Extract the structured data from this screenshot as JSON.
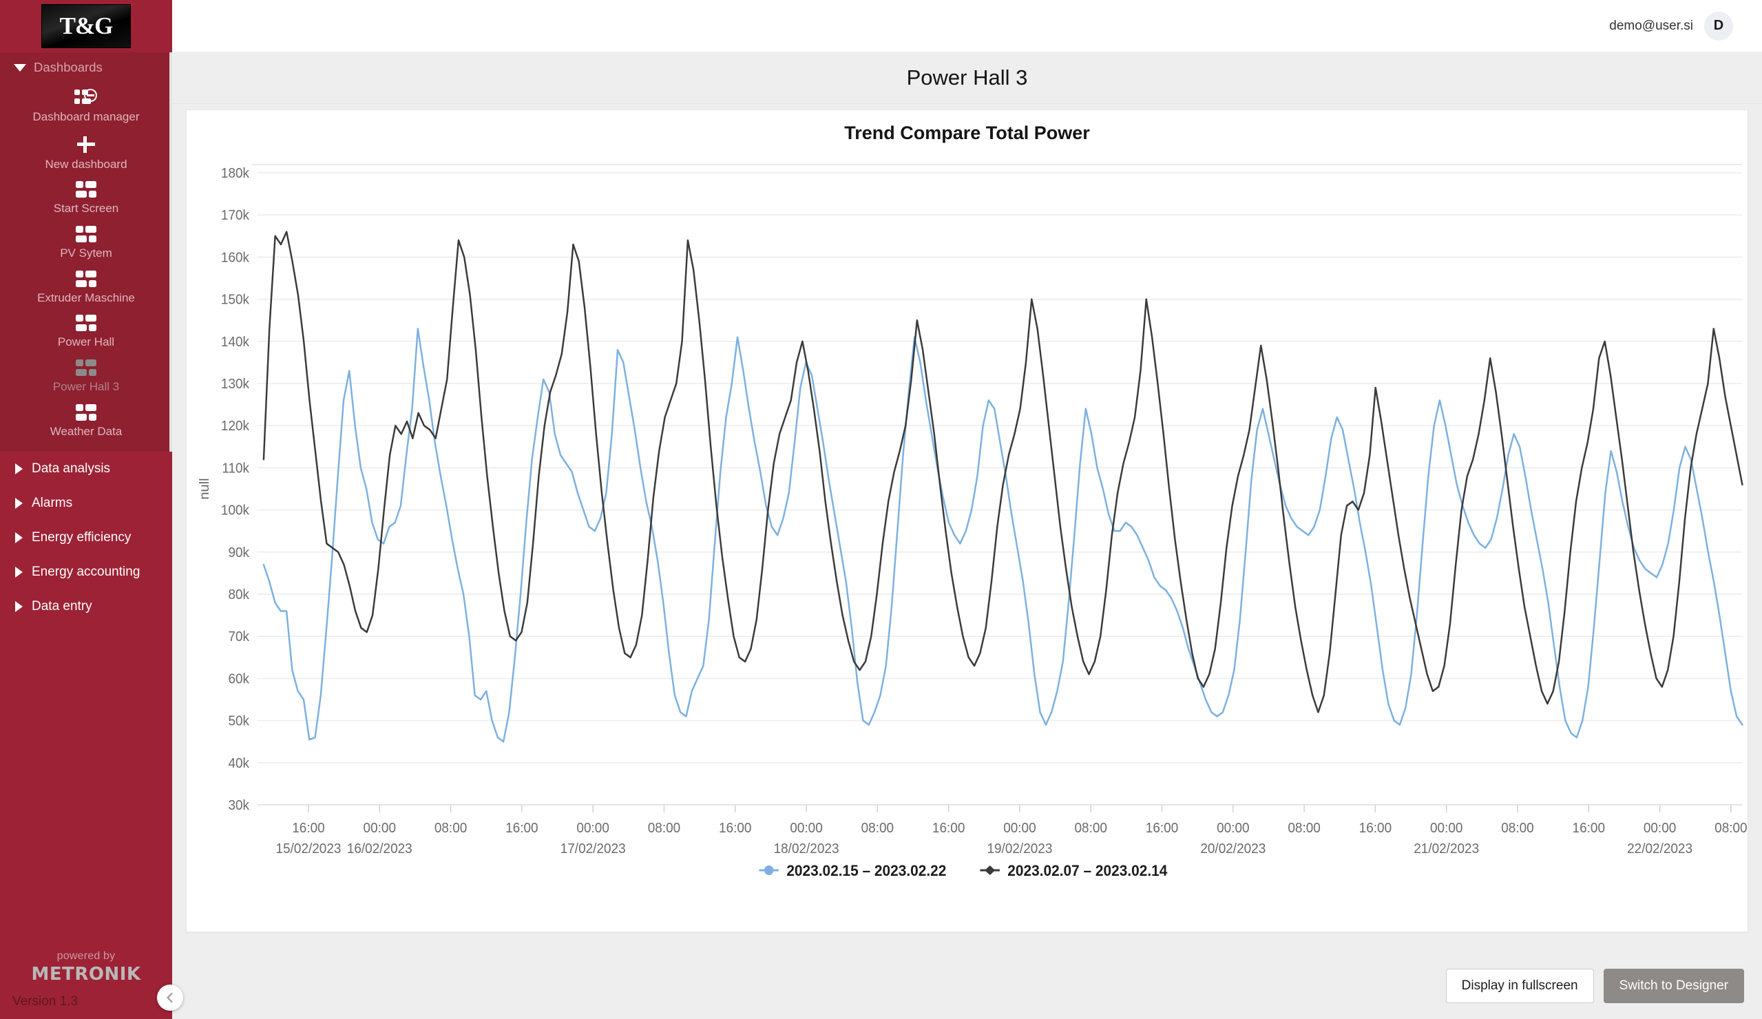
{
  "brand": {
    "logo_text": "T&G",
    "powered_by": "powered by",
    "company": "METRONIK",
    "version": "Version 1.3"
  },
  "topbar": {
    "user_email": "demo@user.si",
    "avatar_initial": "D"
  },
  "sidebar": {
    "dashboards_label": "Dashboards",
    "dashboard_items": [
      {
        "label": "Dashboard manager",
        "icon": "dashboard-manager-icon",
        "active": false
      },
      {
        "label": "New dashboard",
        "icon": "plus-icon",
        "active": false
      },
      {
        "label": "Start Screen",
        "icon": "tiles-icon",
        "active": false
      },
      {
        "label": "PV Sytem",
        "icon": "tiles-icon",
        "active": false
      },
      {
        "label": "Extruder Maschine",
        "icon": "tiles-icon",
        "active": false
      },
      {
        "label": "Power Hall",
        "icon": "tiles-icon",
        "active": false
      },
      {
        "label": "Power Hall 3",
        "icon": "tiles-icon",
        "active": true
      },
      {
        "label": "Weather Data",
        "icon": "tiles-icon",
        "active": false
      }
    ],
    "menu_groups": [
      {
        "label": "Data analysis",
        "icon": "caret-right-icon"
      },
      {
        "label": "Alarms",
        "icon": "caret-right-icon"
      },
      {
        "label": "Energy efficiency",
        "icon": "caret-right-icon"
      },
      {
        "label": "Energy accounting",
        "icon": "caret-right-icon"
      },
      {
        "label": "Data entry",
        "icon": "caret-right-icon"
      }
    ],
    "collapse_icon": "chevron-left-icon"
  },
  "page": {
    "title": "Power Hall 3"
  },
  "footer": {
    "fullscreen_label": "Display in fullscreen",
    "designer_label": "Switch to Designer"
  },
  "colors": {
    "brand_red": "#9d2235",
    "series_blue": "#7cb0e0",
    "series_black": "#3a3a3a",
    "grid": "#ebebeb"
  },
  "chart_data": {
    "type": "line",
    "title": "Trend Compare Total Power",
    "xlabel": "",
    "ylabel": "null",
    "ylim": [
      30000,
      180000
    ],
    "ytick_labels": [
      "180k",
      "170k",
      "160k",
      "150k",
      "140k",
      "130k",
      "120k",
      "110k",
      "100k",
      "90k",
      "80k",
      "70k",
      "60k",
      "50k",
      "40k",
      "30k"
    ],
    "ytick_values": [
      180000,
      170000,
      160000,
      150000,
      140000,
      130000,
      120000,
      110000,
      100000,
      90000,
      80000,
      70000,
      60000,
      50000,
      40000,
      30000
    ],
    "grid": true,
    "legend_position": "bottom",
    "xtick_labels": [
      {
        "time": "16:00",
        "date": "15/02/2023"
      },
      {
        "time": "00:00",
        "date": "16/02/2023"
      },
      {
        "time": "08:00",
        "date": ""
      },
      {
        "time": "16:00",
        "date": ""
      },
      {
        "time": "00:00",
        "date": "17/02/2023"
      },
      {
        "time": "08:00",
        "date": ""
      },
      {
        "time": "16:00",
        "date": ""
      },
      {
        "time": "00:00",
        "date": "18/02/2023"
      },
      {
        "time": "08:00",
        "date": ""
      },
      {
        "time": "16:00",
        "date": ""
      },
      {
        "time": "00:00",
        "date": "19/02/2023"
      },
      {
        "time": "08:00",
        "date": ""
      },
      {
        "time": "16:00",
        "date": ""
      },
      {
        "time": "00:00",
        "date": "20/02/2023"
      },
      {
        "time": "08:00",
        "date": ""
      },
      {
        "time": "16:00",
        "date": ""
      },
      {
        "time": "00:00",
        "date": "21/02/2023"
      },
      {
        "time": "08:00",
        "date": ""
      },
      {
        "time": "16:00",
        "date": ""
      },
      {
        "time": "00:00",
        "date": "22/02/2023"
      },
      {
        "time": "08:00",
        "date": ""
      }
    ],
    "xtick_positions": [
      0.0303,
      0.0784,
      0.1265,
      0.1746,
      0.2227,
      0.2708,
      0.3189,
      0.367,
      0.4151,
      0.4632,
      0.5113,
      0.5594,
      0.6075,
      0.6556,
      0.7037,
      0.7518,
      0.7999,
      0.848,
      0.8961,
      0.9442,
      0.9923
    ],
    "series": [
      {
        "name": "2023.02.15 – 2023.02.22",
        "color": "#7cb0e0",
        "marker": "circle",
        "values": [
          87000,
          83000,
          78000,
          76000,
          76000,
          62000,
          57000,
          55000,
          45500,
          46000,
          56000,
          72000,
          89000,
          108000,
          126000,
          133000,
          120000,
          110000,
          105000,
          97000,
          93000,
          92000,
          96000,
          97000,
          101000,
          113000,
          124000,
          143000,
          134000,
          126000,
          116000,
          108000,
          101000,
          93000,
          86000,
          80000,
          70000,
          56000,
          55000,
          57000,
          50000,
          46000,
          45000,
          52000,
          65000,
          80000,
          97000,
          112000,
          122000,
          131000,
          128000,
          118000,
          113000,
          111000,
          109000,
          104000,
          100000,
          96000,
          95000,
          98000,
          104000,
          118000,
          138000,
          135000,
          127000,
          119000,
          110000,
          102000,
          96000,
          88000,
          78000,
          66000,
          56000,
          52000,
          51000,
          57000,
          60000,
          63000,
          74000,
          92000,
          109000,
          122000,
          130000,
          141000,
          133000,
          124000,
          116000,
          109000,
          101000,
          96000,
          94000,
          98000,
          104000,
          116000,
          129000,
          135000,
          132000,
          124000,
          116000,
          107000,
          99000,
          91000,
          83000,
          72000,
          59000,
          50000,
          49000,
          52000,
          56000,
          63000,
          77000,
          95000,
          113000,
          128000,
          141000,
          135000,
          126000,
          118000,
          110000,
          103000,
          97000,
          94000,
          92000,
          95000,
          100000,
          108000,
          120000,
          126000,
          124000,
          116000,
          108000,
          99000,
          91000,
          83000,
          73000,
          61000,
          52000,
          49000,
          52000,
          57000,
          64000,
          78000,
          94000,
          111000,
          124000,
          118000,
          110000,
          105000,
          99000,
          95000,
          95000,
          97000,
          96000,
          94000,
          91000,
          88000,
          84000,
          82000,
          81000,
          79000,
          76000,
          72000,
          67000,
          63000,
          59000,
          55000,
          52000,
          51000,
          52000,
          56000,
          62000,
          74000,
          90000,
          107000,
          119000,
          124000,
          118000,
          112000,
          106000,
          101000,
          98000,
          96000,
          95000,
          94000,
          96000,
          100000,
          108000,
          117000,
          122000,
          119000,
          112000,
          105000,
          97000,
          90000,
          82000,
          72000,
          62000,
          54000,
          50000,
          49000,
          53000,
          61000,
          75000,
          92000,
          108000,
          120000,
          126000,
          120000,
          113000,
          106000,
          101000,
          97000,
          94000,
          92000,
          91000,
          93000,
          98000,
          105000,
          113000,
          118000,
          115000,
          108000,
          100000,
          93000,
          86000,
          78000,
          68000,
          58000,
          50000,
          47000,
          46000,
          50000,
          58000,
          72000,
          88000,
          104000,
          114000,
          109000,
          102000,
          96000,
          91000,
          88000,
          86000,
          85000,
          84000,
          87000,
          92000,
          100000,
          110000,
          115000,
          112000,
          105000,
          98000,
          90000,
          83000,
          75000,
          66000,
          57000,
          51000,
          49000
        ]
      },
      {
        "name": "2023.02.07 – 2023.02.14",
        "color": "#3a3a3a",
        "marker": "diamond",
        "values": [
          112000,
          143000,
          165000,
          163000,
          166000,
          159000,
          151000,
          140000,
          126000,
          114000,
          102000,
          92000,
          91000,
          90000,
          87000,
          82000,
          76000,
          72000,
          71000,
          75000,
          86000,
          100000,
          113000,
          120000,
          118000,
          121000,
          117000,
          123000,
          120000,
          119000,
          117000,
          124000,
          131000,
          148000,
          164000,
          160000,
          151000,
          138000,
          122000,
          108000,
          96000,
          85000,
          76000,
          70000,
          69000,
          71000,
          78000,
          92000,
          108000,
          120000,
          128000,
          132000,
          137000,
          147000,
          163000,
          159000,
          148000,
          134000,
          118000,
          104000,
          92000,
          81000,
          72000,
          66000,
          65000,
          68000,
          75000,
          88000,
          103000,
          114000,
          122000,
          126000,
          130000,
          140000,
          164000,
          157000,
          145000,
          131000,
          115000,
          101000,
          89000,
          79000,
          70000,
          65000,
          64000,
          67000,
          74000,
          86000,
          100000,
          111000,
          118000,
          122000,
          126000,
          135000,
          140000,
          133000,
          124000,
          114000,
          102000,
          92000,
          83000,
          75000,
          69000,
          64000,
          62000,
          64000,
          70000,
          80000,
          92000,
          102000,
          109000,
          114000,
          120000,
          131000,
          145000,
          138000,
          128000,
          118000,
          106000,
          95000,
          85000,
          77000,
          70000,
          65000,
          63000,
          66000,
          72000,
          83000,
          96000,
          106000,
          113000,
          118000,
          124000,
          135000,
          150000,
          143000,
          132000,
          120000,
          108000,
          96000,
          86000,
          77000,
          70000,
          64000,
          61000,
          64000,
          70000,
          81000,
          94000,
          104000,
          111000,
          116000,
          122000,
          133000,
          150000,
          141000,
          130000,
          118000,
          105000,
          93000,
          83000,
          74000,
          66000,
          60000,
          58000,
          61000,
          67000,
          78000,
          91000,
          101000,
          108000,
          113000,
          119000,
          129000,
          139000,
          131000,
          121000,
          110000,
          98000,
          87000,
          77000,
          69000,
          62000,
          56000,
          52000,
          56000,
          66000,
          80000,
          94000,
          101000,
          102000,
          100000,
          104000,
          113000,
          129000,
          121000,
          112000,
          103000,
          94000,
          86000,
          79000,
          73000,
          67000,
          61000,
          57000,
          58000,
          63000,
          73000,
          87000,
          100000,
          108000,
          112000,
          118000,
          126000,
          136000,
          128000,
          118000,
          107000,
          96000,
          86000,
          77000,
          70000,
          63000,
          57000,
          54000,
          57000,
          64000,
          76000,
          90000,
          102000,
          110000,
          116000,
          124000,
          136000,
          140000,
          132000,
          122000,
          112000,
          101000,
          90000,
          81000,
          73000,
          66000,
          60000,
          58000,
          62000,
          70000,
          83000,
          98000,
          110000,
          118000,
          124000,
          130000,
          143000,
          136000,
          127000,
          120000,
          113000,
          106000
        ]
      }
    ]
  }
}
